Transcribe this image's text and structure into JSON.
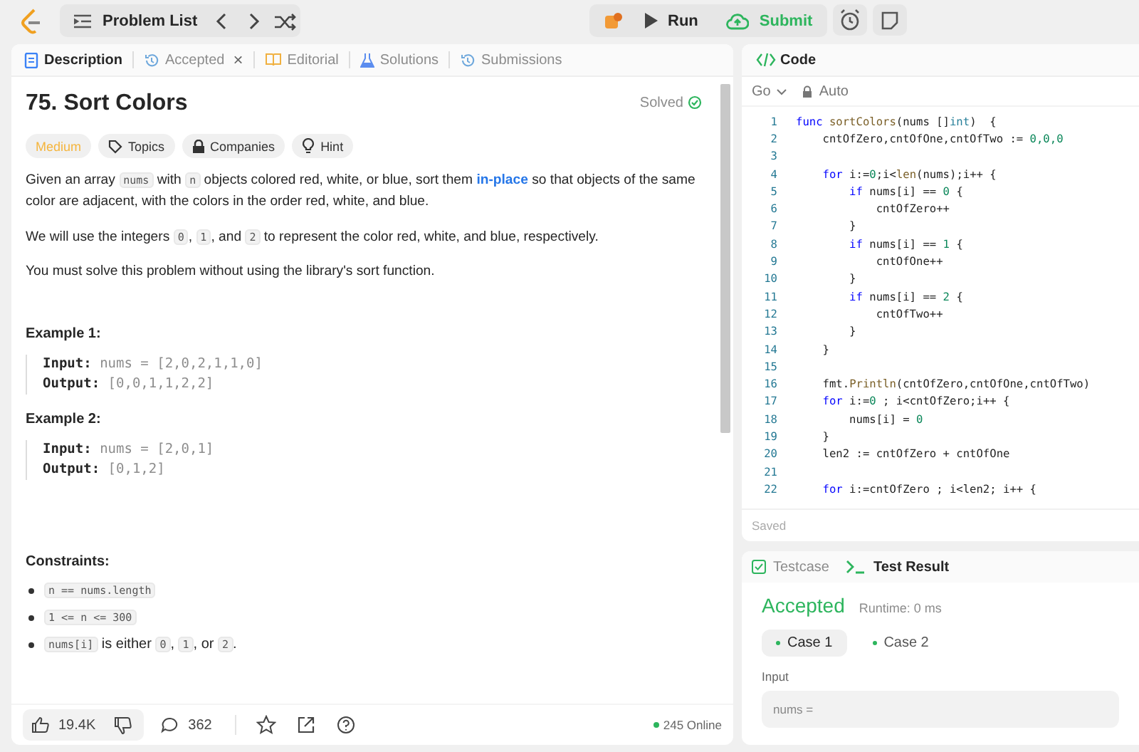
{
  "topbar": {
    "problem_list": "Problem List",
    "run": "Run",
    "submit": "Submit"
  },
  "left_tabs": [
    {
      "label": "Description",
      "selected": true
    },
    {
      "label": "Accepted",
      "selected": false,
      "close": "×"
    },
    {
      "label": "Editorial",
      "selected": false
    },
    {
      "label": "Solutions",
      "selected": false
    },
    {
      "label": "Submissions",
      "selected": false
    }
  ],
  "problem": {
    "title": "75. Sort Colors",
    "status": "Solved",
    "difficulty": "Medium",
    "chips": [
      {
        "label": "Topics"
      },
      {
        "label": "Companies"
      },
      {
        "label": "Hint"
      }
    ],
    "paragraphs": [
      [
        {
          "kind": "text",
          "text": "Given an array "
        },
        {
          "kind": "code",
          "text": "nums"
        },
        {
          "kind": "text",
          "text": " with "
        },
        {
          "kind": "code",
          "text": "n"
        },
        {
          "kind": "text",
          "text": " objects colored red, white, or blue, sort them "
        },
        {
          "kind": "link",
          "text": "in-place"
        },
        {
          "kind": "text",
          "text": " so that objects of the same color are adjacent, with the colors in the order red, white, and blue."
        }
      ],
      [
        {
          "kind": "text",
          "text": "We will use the integers "
        },
        {
          "kind": "code",
          "text": "0"
        },
        {
          "kind": "text",
          "text": ", "
        },
        {
          "kind": "code",
          "text": "1"
        },
        {
          "kind": "text",
          "text": ", and "
        },
        {
          "kind": "code",
          "text": "2"
        },
        {
          "kind": "text",
          "text": " to represent the color red, white, and blue, respectively."
        }
      ],
      [
        {
          "kind": "text",
          "text": "You must solve this problem without using the library's sort function."
        }
      ]
    ],
    "examples": [
      {
        "title": "Example 1:",
        "input_label": "Input:",
        "input": "nums = [2,0,2,1,1,0]",
        "output_label": "Output:",
        "output": "[0,0,1,1,2,2]"
      },
      {
        "title": "Example 2:",
        "input_label": "Input:",
        "input": "nums = [2,0,1]",
        "output_label": "Output:",
        "output": "[0,1,2]"
      }
    ],
    "constraints_title": "Constraints:",
    "constraints": [
      [
        {
          "kind": "code",
          "text": "n == nums.length"
        }
      ],
      [
        {
          "kind": "code",
          "text": "1 <= n <= 300"
        }
      ],
      [
        {
          "kind": "code",
          "text": "nums[i]"
        },
        {
          "kind": "text",
          "text": " is either "
        },
        {
          "kind": "code",
          "text": "0"
        },
        {
          "kind": "text",
          "text": ", "
        },
        {
          "kind": "code",
          "text": "1"
        },
        {
          "kind": "text",
          "text": ", or "
        },
        {
          "kind": "code",
          "text": "2"
        },
        {
          "kind": "text",
          "text": "."
        }
      ]
    ]
  },
  "footer": {
    "likes": "19.4K",
    "comments": "362",
    "online": "245 Online"
  },
  "editor": {
    "title": "Code",
    "language": "Go",
    "mode": "Auto",
    "saved": "Saved",
    "lines": [
      {
        "no": "1",
        "tokens": [
          {
            "kind": "kw",
            "text": "func"
          },
          {
            "kind": "fn",
            "text": " sortColors"
          },
          {
            "kind": "plain",
            "text": "(nums []"
          },
          {
            "kind": "type",
            "text": "int"
          },
          {
            "kind": "plain",
            "text": ")  {"
          }
        ]
      },
      {
        "no": "2",
        "tokens": [
          {
            "kind": "plain",
            "text": "    cntOfZero,cntOfOne,cntOfTwo := "
          },
          {
            "kind": "num",
            "text": "0,0,0"
          }
        ]
      },
      {
        "no": "3"
      },
      {
        "no": "4",
        "tokens": [
          {
            "kind": "kw",
            "text": "    for"
          },
          {
            "kind": "plain",
            "text": " i:="
          },
          {
            "kind": "num",
            "text": "0"
          },
          {
            "kind": "plain",
            "text": ";i<"
          },
          {
            "kind": "fn",
            "text": "len"
          },
          {
            "kind": "plain",
            "text": "(nums);i++ {"
          }
        ]
      },
      {
        "no": "5",
        "tokens": [
          {
            "kind": "kw",
            "text": "        if"
          },
          {
            "kind": "plain",
            "text": " nums[i] == "
          },
          {
            "kind": "num",
            "text": "0"
          },
          {
            "kind": "plain",
            "text": " {"
          }
        ]
      },
      {
        "no": "6",
        "tokens": [
          {
            "kind": "plain",
            "text": "            cntOfZero++"
          }
        ]
      },
      {
        "no": "7",
        "tokens": [
          {
            "kind": "plain",
            "text": "        }"
          }
        ]
      },
      {
        "no": "8",
        "tokens": [
          {
            "kind": "kw",
            "text": "        if"
          },
          {
            "kind": "plain",
            "text": " nums[i] == "
          },
          {
            "kind": "num",
            "text": "1"
          },
          {
            "kind": "plain",
            "text": " {"
          }
        ]
      },
      {
        "no": "9",
        "tokens": [
          {
            "kind": "plain",
            "text": "            cntOfOne++"
          }
        ]
      },
      {
        "no": "10",
        "tokens": [
          {
            "kind": "plain",
            "text": "        }"
          }
        ]
      },
      {
        "no": "11",
        "tokens": [
          {
            "kind": "kw",
            "text": "        if"
          },
          {
            "kind": "plain",
            "text": " nums[i] == "
          },
          {
            "kind": "num",
            "text": "2"
          },
          {
            "kind": "plain",
            "text": " {"
          }
        ]
      },
      {
        "no": "12",
        "tokens": [
          {
            "kind": "plain",
            "text": "            cntOfTwo++"
          }
        ]
      },
      {
        "no": "13",
        "tokens": [
          {
            "kind": "plain",
            "text": "        }"
          }
        ]
      },
      {
        "no": "14",
        "tokens": [
          {
            "kind": "plain",
            "text": "    }"
          }
        ]
      },
      {
        "no": "15"
      },
      {
        "no": "16",
        "tokens": [
          {
            "kind": "plain",
            "text": "    fmt."
          },
          {
            "kind": "fn",
            "text": "Println"
          },
          {
            "kind": "plain",
            "text": "(cntOfZero,cntOfOne,cntOfTwo)"
          }
        ]
      },
      {
        "no": "17",
        "tokens": [
          {
            "kind": "kw",
            "text": "    for"
          },
          {
            "kind": "plain",
            "text": " i:="
          },
          {
            "kind": "num",
            "text": "0"
          },
          {
            "kind": "plain",
            "text": " ; i<cntOfZero;i++ {"
          }
        ]
      },
      {
        "no": "18",
        "tokens": [
          {
            "kind": "plain",
            "text": "        nums[i] = "
          },
          {
            "kind": "num",
            "text": "0"
          }
        ]
      },
      {
        "no": "19",
        "tokens": [
          {
            "kind": "plain",
            "text": "    }"
          }
        ]
      },
      {
        "no": "20",
        "tokens": [
          {
            "kind": "plain",
            "text": "    len2 := cntOfZero + cntOfOne"
          }
        ]
      },
      {
        "no": "21"
      },
      {
        "no": "22",
        "tokens": [
          {
            "kind": "kw",
            "text": "    for"
          },
          {
            "kind": "plain",
            "text": " i:=cntOfZero ; i<len2; i++ {"
          }
        ]
      }
    ]
  },
  "result": {
    "tabs": [
      {
        "label": "Testcase",
        "selected": false
      },
      {
        "label": "Test Result",
        "selected": true
      }
    ],
    "verdict": "Accepted",
    "runtime": "Runtime: 0 ms",
    "cases": [
      {
        "label": "Case 1",
        "selected": true
      },
      {
        "label": "Case 2",
        "selected": false
      }
    ],
    "input_label": "Input",
    "input_value": "nums ="
  }
}
